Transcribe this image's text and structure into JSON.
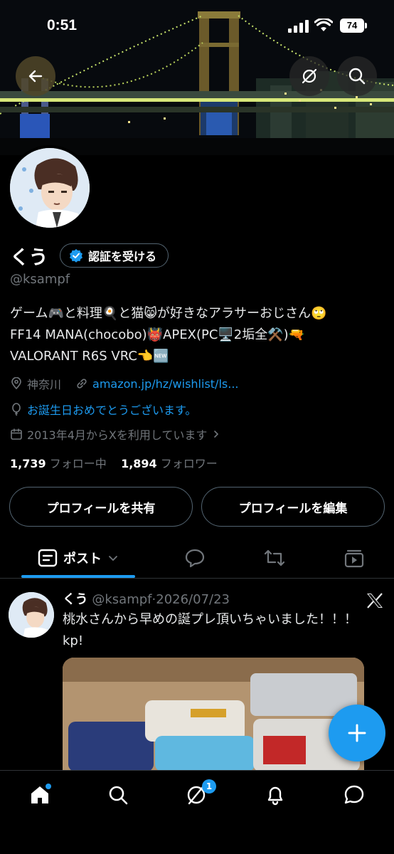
{
  "status_bar": {
    "time": "0:51",
    "battery": "74"
  },
  "profile": {
    "name": "くう",
    "verify_label": "認証を受ける",
    "handle": "@ksampf",
    "bio_lines": [
      "ゲーム🎮と料理🍳と猫😸が好きなアラサーおじさん🙄",
      "FF14 MANA(chocobo)👹APEX(PC🖥️2垢全⚒️)🔫",
      "VALORANT R6S VRC👈🆕"
    ],
    "location": "神奈川",
    "link": "amazon.jp/hz/wishlist/ls...",
    "birthday_text": "お誕生日おめでとうございます。",
    "joined": "2013年4月からXを利用しています",
    "following_count": "1,739",
    "following_label": "フォロー中",
    "followers_count": "1,894",
    "followers_label": "フォロワー",
    "share_label": "プロフィールを共有",
    "edit_label": "プロフィールを編集"
  },
  "tabs": {
    "posts_label": "ポスト"
  },
  "post": {
    "name": "くう",
    "handle": "@ksampf",
    "date": "2026/07/23",
    "text": "桃水さんから早めの誕プレ頂いちゃいました！！！kp!"
  },
  "nav": {
    "grok_badge": "1"
  },
  "colors": {
    "accent": "#1d9bf0",
    "background": "#000000",
    "muted": "#71767b"
  }
}
